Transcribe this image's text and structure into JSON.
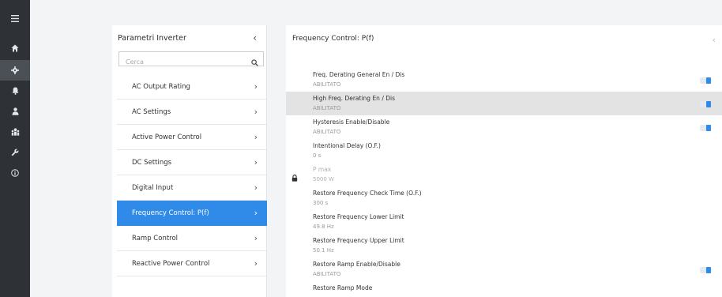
{
  "rail": {
    "items": [
      {
        "icon": "menu-icon",
        "glyph": "☰"
      },
      {
        "icon": "home-icon"
      },
      {
        "icon": "gear-icon"
      },
      {
        "icon": "bell-icon"
      },
      {
        "icon": "user-icon"
      },
      {
        "icon": "users-icon"
      },
      {
        "icon": "wrench-icon"
      },
      {
        "icon": "info-icon",
        "glyph": "ⓘ"
      }
    ],
    "active_index": 2
  },
  "left_panel": {
    "title": "Parametri Inverter",
    "collapse_glyph": "‹",
    "search_placeholder": "Cerca",
    "items": [
      {
        "label": "AC Output Rating",
        "chevron": "›"
      },
      {
        "label": "AC Settings",
        "chevron": "›"
      },
      {
        "label": "Active Power Control",
        "chevron": "›"
      },
      {
        "label": "DC Settings",
        "chevron": "›"
      },
      {
        "label": "Digital Input",
        "chevron": "›"
      },
      {
        "label": "Frequency Control: P(f)",
        "chevron": "›"
      },
      {
        "label": "Ramp Control",
        "chevron": "›"
      },
      {
        "label": "Reactive Power Control",
        "chevron": "›"
      }
    ],
    "active_item": "Frequency Control: P(f)"
  },
  "right_panel": {
    "title": "Frequency Control: P(f)",
    "collapse_glyph": "‹",
    "params": [
      {
        "name": "Freq. Derating General En / Dis",
        "value": "ABILITATO",
        "toggle": true
      },
      {
        "name": "High Freq. Derating En / Dis",
        "value": "ABILITATO",
        "toggle": true
      },
      {
        "name": "Hysteresis Enable/Disable",
        "value": "ABILITATO",
        "toggle": true
      },
      {
        "name": "Intentional Delay (O.F.)",
        "value": "0 s",
        "toggle": false
      },
      {
        "name": "P max",
        "value": "5000 W",
        "toggle": false,
        "locked": true
      },
      {
        "name": "Restore Frequency Check Time (O.F.)",
        "value": "300 s",
        "toggle": false
      },
      {
        "name": "Restore Frequency Lower Limit",
        "value": "49.8 Hz",
        "toggle": false
      },
      {
        "name": "Restore Frequency Upper Limit",
        "value": "50.1 Hz",
        "toggle": false
      },
      {
        "name": "Restore Ramp Enable/Disable",
        "value": "ABILITATO",
        "toggle": true
      },
      {
        "name": "Restore Ramp Mode",
        "value": "",
        "toggle": false
      }
    ],
    "highlighted_index": 1
  },
  "colors": {
    "accent": "#2f8ae8",
    "rail_bg": "#2e3236",
    "highlight_row": "#e3e3e3"
  }
}
